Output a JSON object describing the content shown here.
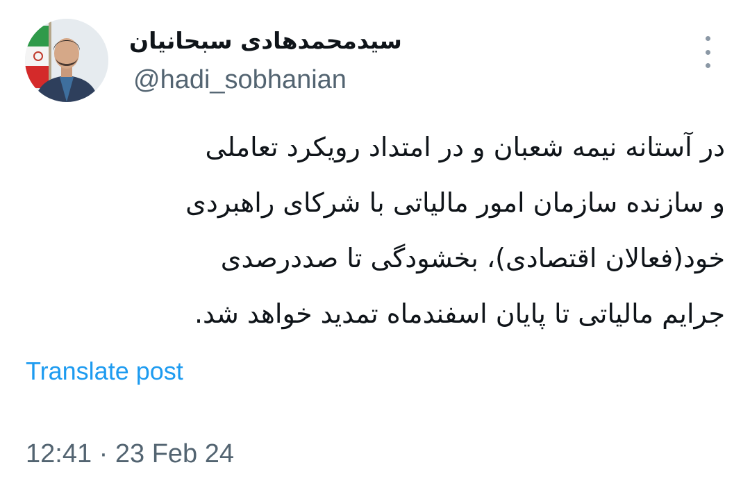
{
  "author": {
    "display_name": "سیدمحمدهادی سبحانیان",
    "handle": "@hadi_sobhanian",
    "avatar_icon": "profile-photo-with-iran-flag"
  },
  "tweet": {
    "lines": [
      "در آستانه نیمه شعبان و در امتداد رویکرد تعاملی",
      "و سازنده سازمان امور مالیاتی با شرکای راهبردی",
      "خود(فعالان اقتصادی)، بخشودگی تا صددرصدی",
      "جرایم مالیاتی تا پایان اسفندماه تمدید خواهد شد."
    ]
  },
  "actions": {
    "translate_label": "Translate post",
    "more_icon": "more-vertical-icon"
  },
  "meta": {
    "timestamp": "12:41 · 23 Feb 24"
  },
  "colors": {
    "text_primary": "#0f1419",
    "text_secondary": "#536471",
    "link": "#1d9bf0"
  }
}
